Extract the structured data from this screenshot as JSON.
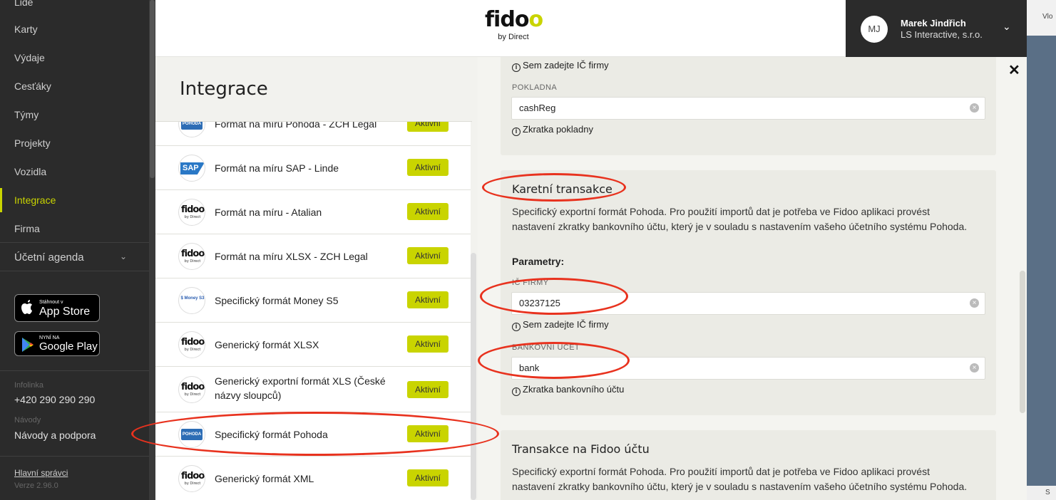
{
  "sidebar": {
    "items": [
      {
        "label": "Lidé"
      },
      {
        "label": "Karty"
      },
      {
        "label": "Výdaje"
      },
      {
        "label": "Cesťáky"
      },
      {
        "label": "Týmy"
      },
      {
        "label": "Projekty"
      },
      {
        "label": "Vozidla"
      },
      {
        "label": "Integrace"
      },
      {
        "label": "Firma"
      }
    ],
    "agenda_label": "Účetní agenda",
    "app_store": {
      "small": "Stáhnout v",
      "big": "App Store"
    },
    "google_play": {
      "small": "NYNÍ NA",
      "big": "Google Play"
    },
    "infolinka_label": "Infolinka",
    "infolinka_value": "+420 290 290 290",
    "navody_label": "Návody",
    "navody_value": "Návody a podpora",
    "admins_link": "Hlavní správci",
    "version": "Verze 2.96.0"
  },
  "header": {
    "logo_word_a": "fid",
    "logo_word_o1": "o",
    "logo_word_o2": "o",
    "logo_sub": "by Direct",
    "user_initials": "MJ",
    "user_name": "Marek Jindřich",
    "user_company": "LS Interactive, s.r.o."
  },
  "right_strip": {
    "top_text": "Vlo",
    "bottom_text": "S"
  },
  "list": {
    "title": "Integrace",
    "badge_label": "Aktivní",
    "items": [
      {
        "label": "Formát na míru Pohoda - ZCH Legal",
        "icon": "pohoda-icon"
      },
      {
        "label": "Formát na míru SAP - Linde",
        "icon": "sap-icon"
      },
      {
        "label": "Formát na míru - Atalian",
        "icon": "fidoo-icon"
      },
      {
        "label": "Formát na míru XLSX - ZCH Legal",
        "icon": "fidoo-icon"
      },
      {
        "label": "Specifický formát Money S5",
        "icon": "money-icon"
      },
      {
        "label": "Generický formát XLSX",
        "icon": "fidoo-icon"
      },
      {
        "label": "Generický exportní formát XLS (České názvy sloupců)",
        "icon": "fidoo-icon"
      },
      {
        "label": "Specifický formát Pohoda",
        "icon": "pohoda-icon"
      },
      {
        "label": "Generický formát XML",
        "icon": "fidoo-icon"
      }
    ],
    "icon_text": {
      "pohoda": "POHODA",
      "sap": "SAP",
      "money": "$ Money S3",
      "fidoo": "fidoo",
      "fidoo_sub": "by Direct"
    }
  },
  "detail": {
    "top_hint_ic": "Sem zadejte IČ firmy",
    "pokladna_label": "POKLADNA",
    "pokladna_value": "cashReg",
    "pokladna_hint": "Zkratka pokladny",
    "card_title": "Karetní transakce",
    "card_desc": "Specifický exportní formát Pohoda. Pro použití importů dat je potřeba ve Fidoo aplikaci provést nastavení zkratky bankovního účtu, který je v souladu s nastavením vašeho účetního systému Pohoda.",
    "params_label": "Parametry:",
    "ic_label": "IČ FIRMY",
    "ic_value": "03237125",
    "ic_hint": "Sem zadejte IČ firmy",
    "bank_label": "BANKOVNÍ ÚČET",
    "bank_value": "bank",
    "bank_hint": "Zkratka bankovního účtu",
    "card2_title": "Transakce na Fidoo účtu",
    "card2_desc": "Specifický exportní formát Pohoda. Pro použití importů dat je potřeba ve Fidoo aplikaci provést nastavení zkratky bankovního účtu, který je v souladu s nastavením vašeho účetního systému Pohoda.",
    "close": "✕",
    "info_glyph": "i",
    "clear_glyph": "×"
  },
  "colors": {
    "accent": "#c9d400",
    "annotation": "#e8321e",
    "sidebar_bg": "#2b2b2b"
  }
}
